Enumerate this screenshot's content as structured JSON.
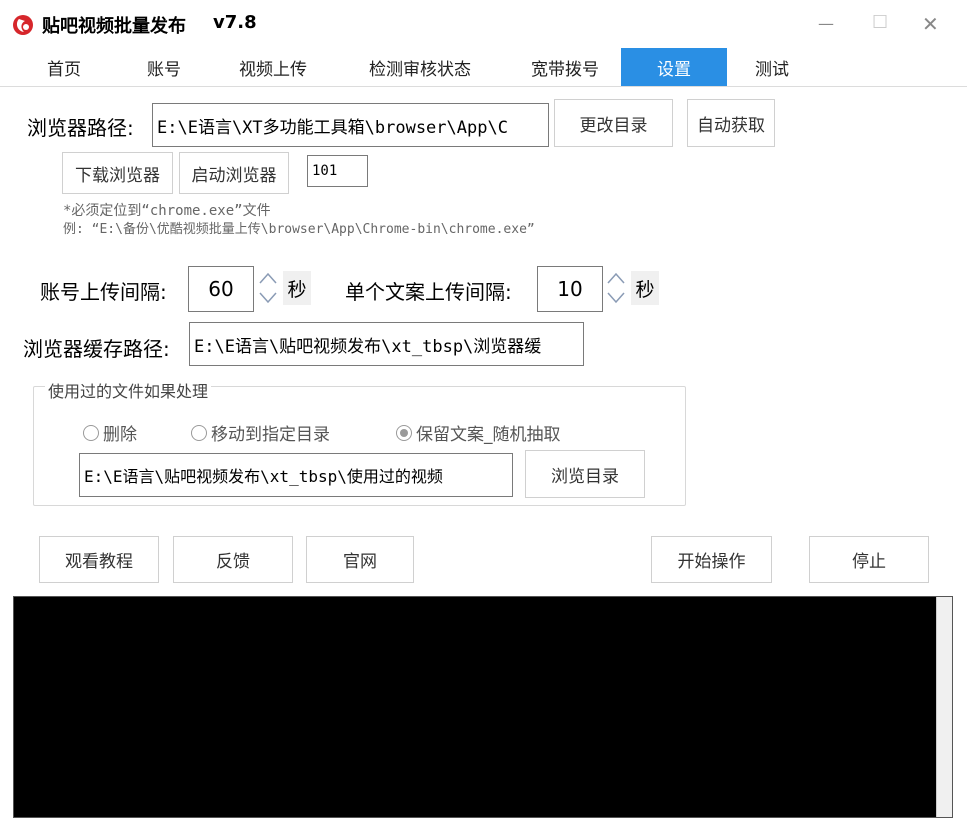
{
  "window": {
    "title": "贴吧视频批量发布",
    "version": "v7.8",
    "controls": {
      "minimize": "—",
      "maximize": "☐",
      "close": "✕"
    }
  },
  "tabs": [
    {
      "label": "首页"
    },
    {
      "label": "账号"
    },
    {
      "label": "视频上传"
    },
    {
      "label": "检测审核状态"
    },
    {
      "label": "宽带拨号"
    },
    {
      "label": "设置"
    },
    {
      "label": "测试"
    }
  ],
  "settings": {
    "browser_path_label": "浏览器路径:",
    "browser_path_value": "E:\\E语言\\XT多功能工具箱\\browser\\App\\C",
    "change_dir_button": "更改目录",
    "auto_get_button": "自动获取",
    "download_browser_button": "下载浏览器",
    "launch_browser_button": "启动浏览器",
    "port_value": "101",
    "hint_line1": "*必须定位到“chrome.exe”文件",
    "hint_line2": "例: “E:\\备份\\优酷视频批量上传\\browser\\App\\Chrome-bin\\chrome.exe”",
    "account_interval_label": "账号上传间隔:",
    "account_interval_value": "60",
    "account_interval_unit": "秒",
    "copy_interval_label": "单个文案上传间隔:",
    "copy_interval_value": "10",
    "copy_interval_unit": "秒",
    "cache_path_label": "浏览器缓存路径:",
    "cache_path_value": "E:\\E语言\\贴吧视频发布\\xt_tbsp\\浏览器缓"
  },
  "used_files": {
    "group_title": "使用过的文件如果处理",
    "option_delete": "删除",
    "option_move": "移动到指定目录",
    "option_keep": "保留文案_随机抽取",
    "selected": "option_keep",
    "path_value": "E:\\E语言\\贴吧视频发布\\xt_tbsp\\使用过的视频",
    "browse_button": "浏览目录"
  },
  "actions": {
    "tutorial": "观看教程",
    "feedback": "反馈",
    "website": "官网",
    "start": "开始操作",
    "stop": "停止"
  },
  "colors": {
    "tab_active": "#2a8fe4",
    "log_background": "#000000"
  }
}
